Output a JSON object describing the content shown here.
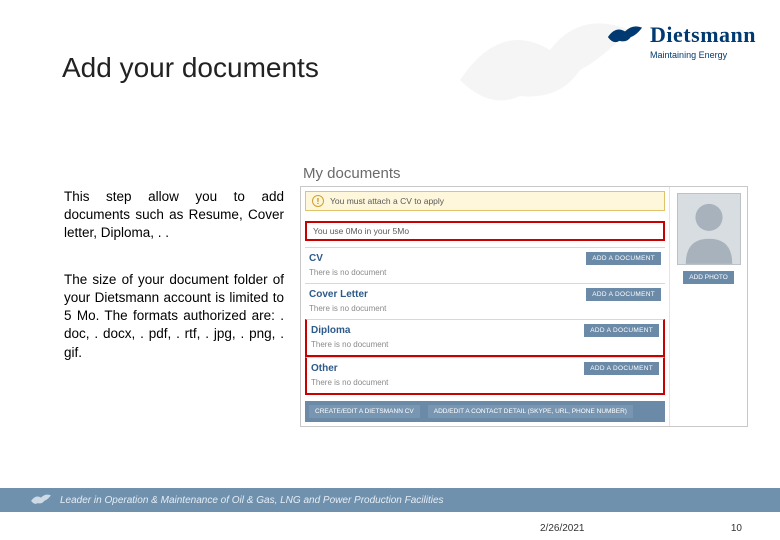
{
  "title": "Add your documents",
  "logo": {
    "name": "Dietsmann",
    "tagline": "Maintaining Energy"
  },
  "para1": "This step allow you to add documents such as Resume, Cover letter, Diploma, . .",
  "para2": "The size of your document folder of your Dietsmann account is limited to 5 Mo. The formats authorized are: . doc, . docx, . pdf, . rtf, . jpg, . png, . gif.",
  "panel": {
    "heading": "My documents",
    "warning": "You must attach a CV to apply",
    "usage": "You use 0Mo in your 5Mo",
    "sections": [
      {
        "label": "CV",
        "empty": "There is no document",
        "btn": "ADD A DOCUMENT"
      },
      {
        "label": "Cover Letter",
        "empty": "There is no document",
        "btn": "ADD A DOCUMENT"
      },
      {
        "label": "Diploma",
        "empty": "There is no document",
        "btn": "ADD A DOCUMENT"
      },
      {
        "label": "Other",
        "empty": "There is no document",
        "btn": "ADD A DOCUMENT"
      }
    ],
    "bottom": {
      "b1": "CREATE/EDIT A DIETSMANN CV",
      "b2": "ADD/EDIT A CONTACT DETAIL (SKYPE, URL, PHONE NUMBER)"
    },
    "photo_btn": "ADD PHOTO"
  },
  "footer": "Leader in Operation & Maintenance of Oil & Gas, LNG and Power Production Facilities",
  "date": "2/26/2021",
  "page": "10"
}
